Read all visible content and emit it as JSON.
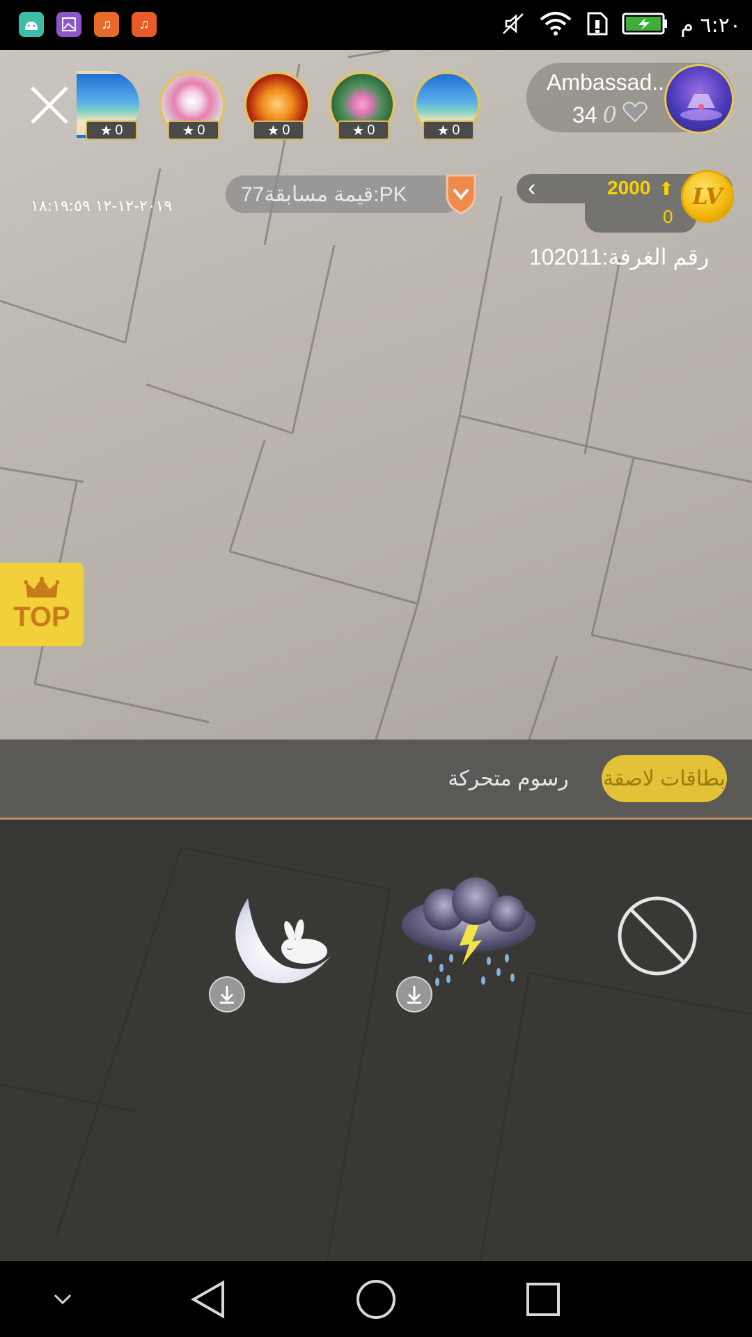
{
  "status_bar": {
    "time": "٦:٢٠ م",
    "app_icons": [
      {
        "name": "android-icon",
        "color": "#3dbda9"
      },
      {
        "name": "gallery-icon",
        "color": "#8e56c8"
      },
      {
        "name": "music-icon",
        "color": "#e86a2a"
      },
      {
        "name": "music-icon-2",
        "color": "#e85c2a"
      }
    ],
    "icons": [
      "mute-icon",
      "wifi-icon",
      "sim-icon",
      "battery-icon"
    ]
  },
  "host": {
    "name": "Ambassad...",
    "followers": "34",
    "likes": "0"
  },
  "viewers": [
    {
      "stars": "0",
      "theme": "beach"
    },
    {
      "stars": "0",
      "theme": "flower"
    },
    {
      "stars": "0",
      "theme": "fire"
    },
    {
      "stars": "0",
      "theme": "lotus"
    },
    {
      "stars": "0",
      "theme": "beach"
    }
  ],
  "pk": {
    "label": "قيمة مسابقة77:PK"
  },
  "timestamp": "٢٠١٩-١٢-١٢ ١٨:١٩:٥٩",
  "level": {
    "value": "2000",
    "sub_value": "0",
    "badge": "LV"
  },
  "room": {
    "label": "رقم الغرفة:102011"
  },
  "top_button": {
    "label": "TOP"
  },
  "panel": {
    "tabs": [
      {
        "label": "بطاقات لاصقة",
        "active": true
      },
      {
        "label": "رسوم متحركة",
        "active": false
      }
    ],
    "stickers": [
      {
        "name": "none-sticker"
      },
      {
        "name": "storm-cloud-sticker",
        "downloadable": true
      },
      {
        "name": "moon-rabbit-sticker",
        "downloadable": true
      }
    ]
  },
  "colors": {
    "accent": "#e2c236",
    "level_text": "#f6d200",
    "top_button": "#f1d03a",
    "tab_divider": "#c4916a"
  }
}
